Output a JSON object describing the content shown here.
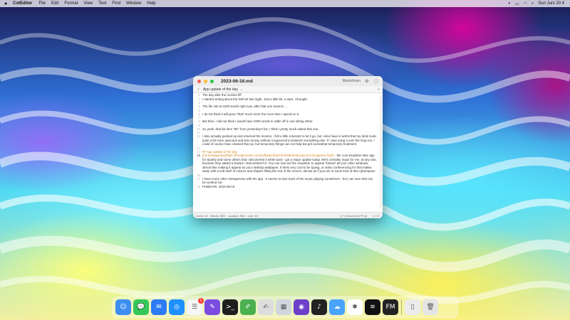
{
  "menubar": {
    "app_name": "CotEditor",
    "items": [
      "File",
      "Edit",
      "Format",
      "View",
      "Text",
      "Find",
      "Window",
      "Help"
    ],
    "datetime": "Sun Juni 20 4"
  },
  "window": {
    "filename": "2023-06-16.md",
    "syntax": "Markdown",
    "tab_label": "App update of the day",
    "lines": [
      {
        "n": "1",
        "text": "The day after the monitor liff",
        "type": "normal"
      },
      {
        "n": "2",
        "text": "I started writing about the Dell 8K last night. Just a little bit, a start, I thought.",
        "type": "normal"
      },
      {
        "n": "3",
        "text": "",
        "type": "gap"
      },
      {
        "n": "4",
        "text": "The file sits at 2200 words right now, after that one session ...",
        "type": "normal"
      },
      {
        "n": "5",
        "text": "",
        "type": "gap"
      },
      {
        "n": "6",
        "text": "I do not think it will grow *that* much more the more time I spend on it.",
        "type": "normal"
      },
      {
        "n": "7",
        "text": "",
        "type": "gap"
      },
      {
        "n": "8",
        "text": "But then, I did not think I would have 2000 words to rattle off in one sitting either.",
        "type": "normal"
      },
      {
        "n": "9",
        "text": "",
        "type": "gap"
      },
      {
        "n": "10",
        "text": "So yeah, that list item \"9K\" from yesterday's list, I think I pretty much nailed that one.",
        "type": "normal"
      },
      {
        "n": "11",
        "text": "",
        "type": "gap"
      },
      {
        "n": "12",
        "text": "I also actually packed up and returned the monitor. I felt a little reluctant to let it go, but I also have to admit that my desk looks quite a bit more spacious and less messy without it squeezed in between everything else. If I was using it over the long run, I could of course have cleaned that up, but temporary things can not help but get somewhat temporary treatment.",
        "type": "normal"
      },
      {
        "n": "13",
        "text": "",
        "type": "gap"
      },
      {
        "n": "14",
        "text": "## App update of the day",
        "type": "heading"
      },
      {
        "n": "15",
        "text": "[Fermimagnetic](https://freedprocess.com/software/2021/04/30/introducing-fermimagnetic.html) - the cool visualizer Mac app for Spotify and some others that I discovered a while back - got a major update today. Well, certainly major for me, at any rate, because they added a feature I had wished for: You can now set the visualizer to appear *below* all your other windows, almost like making it appear as your desktop wallpaper. It feels very cool to be typing, or video conferencing for that matter, away with a soft swirl of colours and shapes filling the rest of the screen, almost as if you are in some kind of 90s cyberspace.",
        "type": "link",
        "current": true
      },
      {
        "n": "16",
        "text": "",
        "type": "gap"
      },
      {
        "n": "17",
        "text": "I have some other strangeness with the app - it seems to lose track of the music playing sometimes - but I am sure that can be worked out.",
        "type": "normal"
      },
      {
        "n": "18",
        "text": "PUBDATE: 2023-06-16",
        "type": "normal"
      }
    ],
    "status_left": [
      "Lines: 18",
      "Words: 563",
      "Location: 550",
      "Line: 15"
    ],
    "status_right": "LF  |  Unicode (UTF-8)",
    "status_pos": "1 / 17"
  },
  "dock": {
    "apps": [
      {
        "name": "finder-icon",
        "glyph": "☺",
        "color": "#3d8ef0"
      },
      {
        "name": "messages-icon",
        "glyph": "💬",
        "color": "#34c759"
      },
      {
        "name": "mail-icon",
        "glyph": "✉",
        "color": "#2d7cf6"
      },
      {
        "name": "safari-icon",
        "glyph": "◎",
        "color": "#1e90ff"
      },
      {
        "name": "reminders-icon",
        "glyph": "☰",
        "color": "#f5f5f5",
        "badge": "1"
      },
      {
        "name": "notes-icon",
        "glyph": "✎",
        "color": "#7a4de0"
      },
      {
        "name": "terminal-icon",
        "glyph": ">_",
        "color": "#1e1e1e"
      },
      {
        "name": "coteditor-icon",
        "glyph": "✐",
        "color": "#4caf50"
      },
      {
        "name": "textedit-icon",
        "glyph": "✍",
        "color": "#ddd"
      },
      {
        "name": "preview-icon",
        "glyph": "▦",
        "color": "#cfd6de"
      },
      {
        "name": "github-icon",
        "glyph": "◉",
        "color": "#6e40c9"
      },
      {
        "name": "audio-icon",
        "glyph": "♪",
        "color": "#222"
      },
      {
        "name": "cloud-icon",
        "glyph": "☁",
        "color": "#4aa3ff"
      },
      {
        "name": "slack-icon",
        "glyph": "✱",
        "color": "#ffffff"
      },
      {
        "name": "spotify-icon",
        "glyph": "≋",
        "color": "#111"
      },
      {
        "name": "fm-icon",
        "glyph": "FM",
        "color": "#222"
      }
    ],
    "trash": [
      {
        "name": "document-icon",
        "glyph": "▯",
        "color": "#ececec"
      },
      {
        "name": "trash-icon",
        "glyph": "🗑",
        "color": "#e5e5e5"
      }
    ]
  }
}
